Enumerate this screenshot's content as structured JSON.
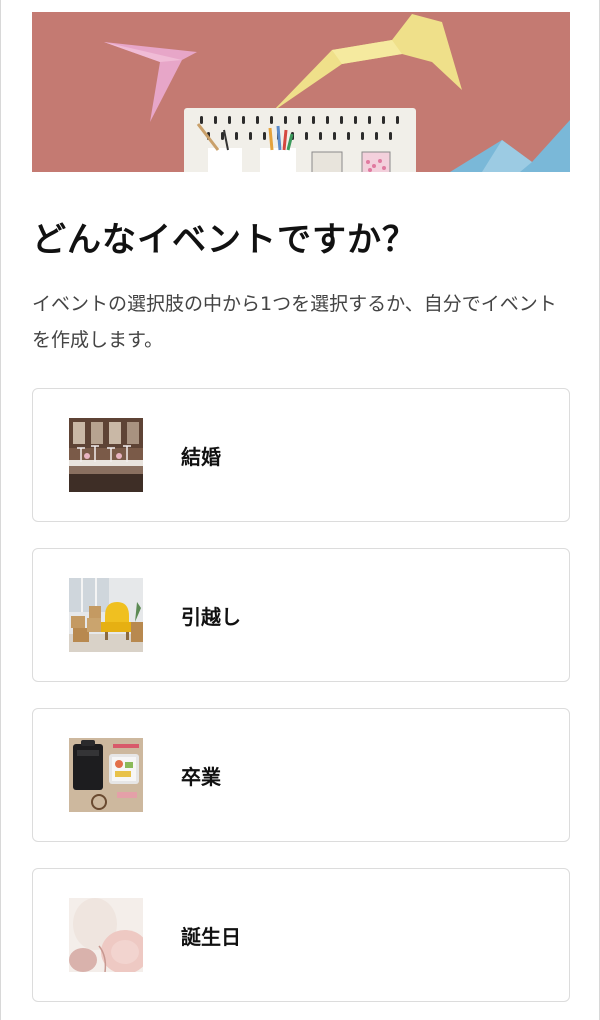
{
  "page": {
    "title": "どんなイベントですか？",
    "description": "イベントの選択肢の中から1つを選択するか、自分でイベントを作成します。"
  },
  "events": [
    {
      "label": "結婚",
      "image": "wedding-table-photo"
    },
    {
      "label": "引越し",
      "image": "moving-boxes-yellow-armchair-photo"
    },
    {
      "label": "卒業",
      "image": "backpack-and-lunchbox-photo"
    },
    {
      "label": "誕生日",
      "image": "balloons-photo"
    }
  ],
  "colors": {
    "hero_background": "#c47a72",
    "card_border": "#dcdcdc",
    "text": "#111111"
  }
}
